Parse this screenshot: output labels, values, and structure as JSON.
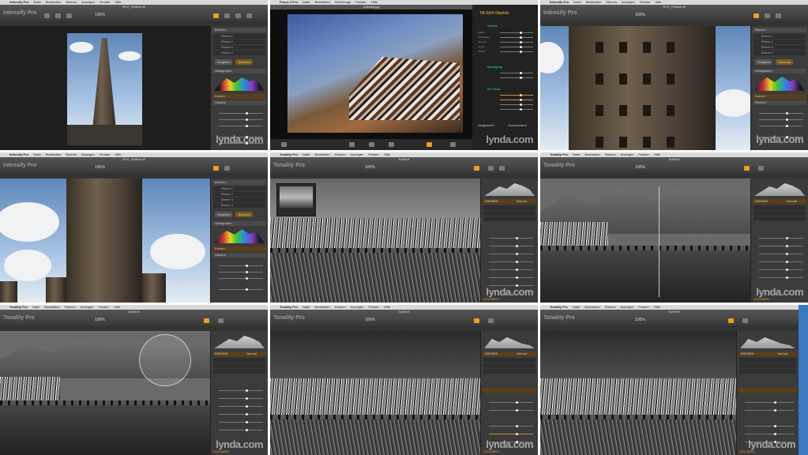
{
  "menu_intensify": [
    "Intensify Pro",
    "Datei",
    "Bearbeiten",
    "Ebenen",
    "Anzeigen",
    "Fenster",
    "Hilfe"
  ],
  "menu_focus": [
    "Focus 2 Pro",
    "Datei",
    "Bearbeiten",
    "Werkzeuge",
    "Fenster",
    "Hilfe"
  ],
  "menu_tonality": [
    "Tonality Pro",
    "Datei",
    "Bearbeiten",
    "Ebenen",
    "Anzeigen",
    "Fenster",
    "Hilfe"
  ],
  "logos": {
    "intensify": "Intensify Pro",
    "tonality": "Tonality Pro"
  },
  "titles": {
    "flatiron": "NYC_Flatiron.tif",
    "focus": "Hallstatt.jpg",
    "reeds": "Schilf.tif"
  },
  "zoom": "100%",
  "panel": {
    "ebenen": "EBENEN",
    "ebenen_intensify": "Ebenen",
    "layers": [
      "Ebene 1",
      "Ebene 2",
      "Ebene 3",
      "Ebene 4"
    ],
    "histogram": "Histogramm",
    "kurven": "Kurven",
    "helligkeit": "Helligkeit",
    "kontrast": "Kontrast",
    "struktur": "Struktur",
    "details": "Details",
    "zwischenstand": "Zwischenstand",
    "vergleich": "Vergleich",
    "ansehen": "Ansehen",
    "volumen": "VOLUMEN",
    "modus": "Modus",
    "normal": "Normal"
  },
  "focus_panel": {
    "title": "Tilt-Shift Objektiv",
    "weiche": "Weiche",
    "bewegung": "Bewegung",
    "im_fokus": "Im Fokus",
    "rows": [
      "Stärke",
      "Übergänge",
      "Zentrum",
      "Größe",
      "Winkel"
    ],
    "vergleichen": "Vergleichen",
    "zuruecksetzen": "Zurücksetzen"
  },
  "watermark": "lynda.com",
  "accent": "#e8a020"
}
